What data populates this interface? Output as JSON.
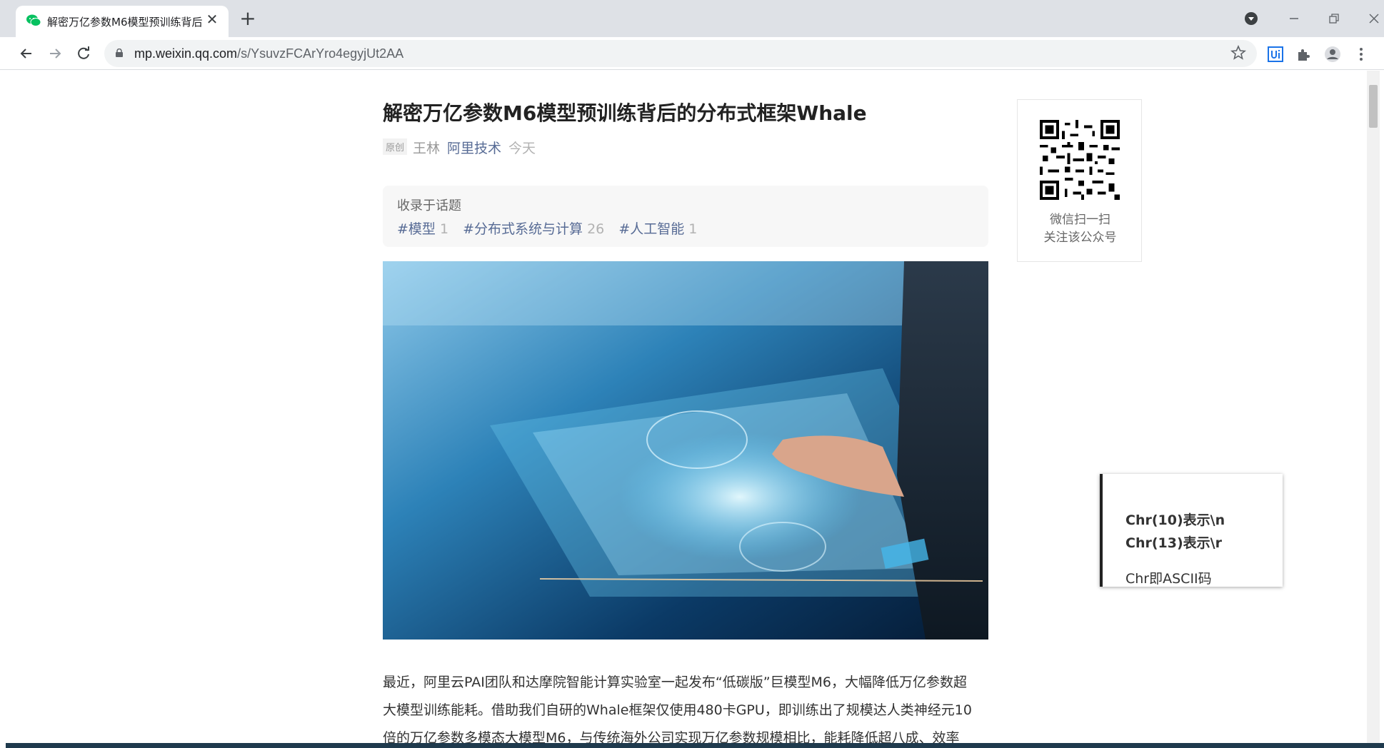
{
  "browser": {
    "tab_title": "解密万亿参数M6模型预训练背后",
    "tab_close": "✕",
    "new_tab": "+",
    "url_host": "mp.weixin.qq.com",
    "url_path": "/s/YsuvzFCArYro4egyjUt2AA"
  },
  "article": {
    "title": "解密万亿参数M6模型预训练背后的分布式框架Whale",
    "original_badge": "原创",
    "author": "王林",
    "account": "阿里技术",
    "date": "今天",
    "topics_label": "收录于话题",
    "topics": [
      {
        "name": "#模型",
        "count": "1"
      },
      {
        "name": "#分布式系统与计算",
        "count": "26"
      },
      {
        "name": "#人工智能",
        "count": "1"
      }
    ],
    "paragraph_lines": [
      "最近，阿里云PAI团队和达摩院智能计算实验室一起发布“低碳版”巨模型M6，大幅降低万亿参数超",
      "大模型训练能耗。借助我们自研的Whale框架仅使用480卡GPU，即训练出了规模达人类神经元10",
      "倍的万亿参数多模态大模型M6，与传统海外公司实现万亿参数规模相比，能耗降低超八成、效率"
    ]
  },
  "sidebar": {
    "qr_caption_line1": "微信扫一扫",
    "qr_caption_line2": "关注该公众号"
  },
  "note_popup": {
    "line1": "Chr(10)表示\\n",
    "line2": "Chr(13)表示\\r",
    "line3": "Chr即ASCII码"
  },
  "icons": [
    "wechat-icon",
    "close-icon",
    "plus-icon",
    "media-icon",
    "minimize-icon",
    "restore-icon",
    "window-close-icon",
    "back-icon",
    "forward-icon",
    "reload-icon",
    "lock-icon",
    "star-icon",
    "uipath-icon",
    "extensions-icon",
    "profile-icon",
    "menu-icon",
    "qr-code-icon"
  ]
}
